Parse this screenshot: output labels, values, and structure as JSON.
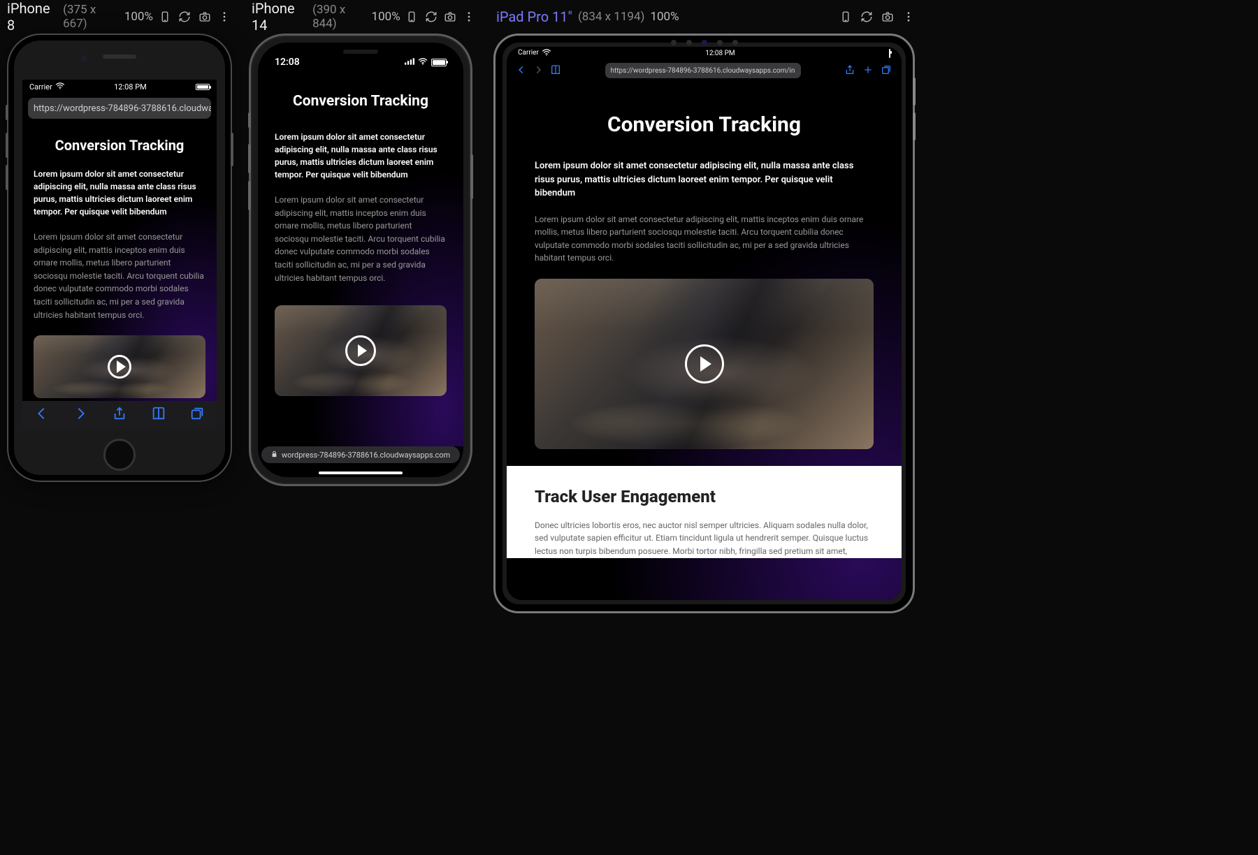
{
  "devices": {
    "iphone8": {
      "name": "iPhone 8",
      "dims": "(375 x 667)",
      "zoom": "100%"
    },
    "iphone14": {
      "name": "iPhone 14",
      "dims": "(390 x 844)",
      "zoom": "100%"
    },
    "ipad": {
      "name": "iPad Pro 11\"",
      "dims": "(834 x 1194)",
      "zoom": "100%"
    }
  },
  "status": {
    "iphone8": {
      "carrier": "Carrier",
      "time": "12:08 PM"
    },
    "iphone14": {
      "time": "12:08"
    },
    "ipad": {
      "carrier": "Carrier",
      "time": "12:08 PM"
    }
  },
  "urls": {
    "iphone8": "https://wordpress-784896-3788616.cloudwaysa",
    "iphone14_domain": "wordpress-784896-3788616.cloudwaysapps.com",
    "ipad": "https://wordpress-784896-3788616.cloudwaysapps.com/in"
  },
  "page": {
    "title": "Conversion Tracking",
    "lead": "Lorem ipsum dolor sit amet consectetur adipiscing elit, nulla massa ante class risus purus, mattis ultricies dictum laoreet enim tempor. Per quisque velit bibendum",
    "para": "Lorem ipsum dolor sit amet consectetur adipiscing elit, mattis inceptos enim duis ornare mollis, metus libero parturient sociosqu molestie taciti. Arcu torquent cubilia donec vulputate commodo morbi sodales taciti sollicitudin ac, mi per a sed gravida ultricies habitant tempus orci.",
    "section2_title": "Track User Engagement",
    "section2_para": "Donec ultricies lobortis eros, nec auctor nisl semper ultricies. Aliquam sodales nulla dolor, sed vulputate sapien efficitur ut. Etiam tincidunt ligula ut hendrerit semper. Quisque luctus lectus non turpis bibendum posuere. Morbi tortor nibh, fringilla sed pretium sit amet,"
  },
  "colors": {
    "accent_ipad_title": "#7b7bff",
    "safari_blue": "#3478f6"
  }
}
